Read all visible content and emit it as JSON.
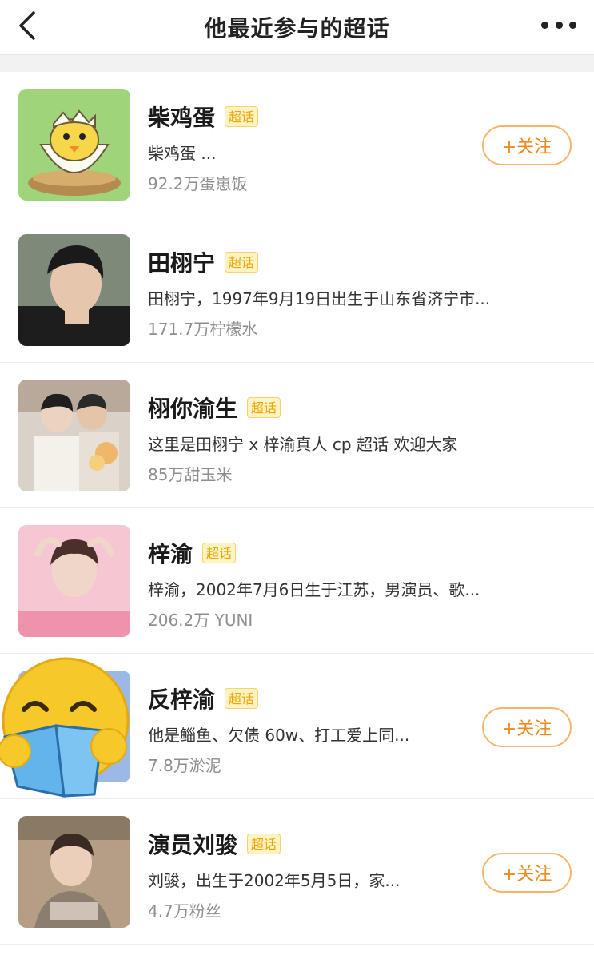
{
  "header": {
    "title": "他最近参与的超话"
  },
  "tag_label": "超话",
  "follow_label": "+关注",
  "colors": {
    "accent": "#ee8a1e",
    "tag_text": "#f0a400",
    "tag_bg": "#fff3c4"
  },
  "items": [
    {
      "name": "柴鸡蛋",
      "desc": "柴鸡蛋 ...",
      "stat": "92.2万蛋崽饭",
      "has_follow": true
    },
    {
      "name": "田栩宁",
      "desc": "田栩宁，1997年9月19日出生于山东省济宁市...",
      "stat": "171.7万柠檬水",
      "has_follow": false
    },
    {
      "name": "栩你渝生",
      "desc": "这里是田栩宁 x 梓渝真人 cp 超话 欢迎大家",
      "stat": "85万甜玉米",
      "has_follow": false
    },
    {
      "name": "梓渝",
      "desc": "梓渝，2002年7月6日生于江苏，男演员、歌...",
      "stat": "206.2万 YUNI",
      "has_follow": false
    },
    {
      "name": "反梓渝",
      "desc": "他是鲻鱼、欠债 60w、打工爱上同...",
      "stat": "7.8万淤泥",
      "has_follow": true
    },
    {
      "name": "演员刘骏",
      "desc": "刘骏，出生于2002年5月5日，家...",
      "stat": "4.7万粉丝",
      "has_follow": true
    }
  ]
}
